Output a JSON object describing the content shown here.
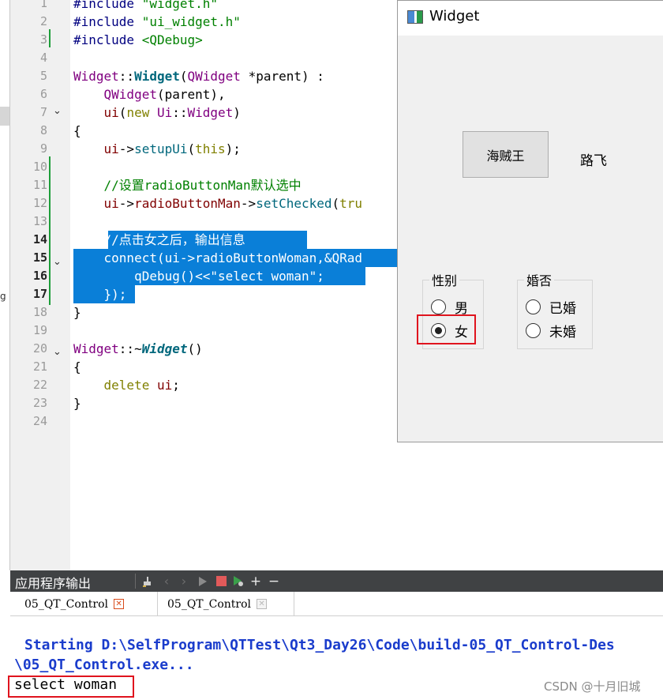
{
  "editor": {
    "line_numbers": [
      "1",
      "2",
      "3",
      "4",
      "5",
      "6",
      "7",
      "8",
      "9",
      "10",
      "11",
      "12",
      "13",
      "14",
      "15",
      "16",
      "17",
      "18",
      "19",
      "20",
      "21",
      "22",
      "23",
      "24"
    ],
    "lines": [
      {
        "t": [
          [
            "kw-dir",
            "#include "
          ],
          [
            "str",
            "\"widget.h\""
          ]
        ]
      },
      {
        "t": [
          [
            "kw-dir",
            "#include "
          ],
          [
            "str",
            "\"ui_widget.h\""
          ]
        ]
      },
      {
        "t": [
          [
            "kw-dir",
            "#include "
          ],
          [
            "str",
            "<QDebug>"
          ]
        ]
      },
      {
        "t": []
      },
      {
        "t": [
          [
            "cls",
            "Widget"
          ],
          [
            "op",
            "::"
          ],
          [
            "fn-bold",
            "Widget"
          ],
          [
            "op",
            "("
          ],
          [
            "cls",
            "QWidget"
          ],
          [
            "op",
            " *parent) :"
          ]
        ]
      },
      {
        "t": [
          [
            "op",
            "    "
          ],
          [
            "cls",
            "QWidget"
          ],
          [
            "op",
            "(parent),"
          ]
        ]
      },
      {
        "t": [
          [
            "op",
            "    "
          ],
          [
            "mem",
            "ui"
          ],
          [
            "op",
            "("
          ],
          [
            "kw",
            "new "
          ],
          [
            "cls",
            "Ui"
          ],
          [
            "op",
            "::"
          ],
          [
            "cls",
            "Widget"
          ],
          [
            "op",
            ")"
          ]
        ]
      },
      {
        "t": [
          [
            "op",
            "{"
          ]
        ]
      },
      {
        "t": [
          [
            "op",
            "    "
          ],
          [
            "mem",
            "ui"
          ],
          [
            "op",
            "->"
          ],
          [
            "fn",
            "setupUi"
          ],
          [
            "op",
            "("
          ],
          [
            "kw",
            "this"
          ],
          [
            "op",
            ");"
          ]
        ]
      },
      {
        "t": []
      },
      {
        "t": [
          [
            "op",
            "    "
          ],
          [
            "cmt",
            "//设置radioButtonMan默认选中"
          ]
        ]
      },
      {
        "t": [
          [
            "op",
            "    "
          ],
          [
            "mem",
            "ui"
          ],
          [
            "op",
            "->"
          ],
          [
            "mem",
            "radioButtonMan"
          ],
          [
            "op",
            "->"
          ],
          [
            "fn",
            "setChecked"
          ],
          [
            "op",
            "("
          ],
          [
            "kw",
            "tru"
          ]
        ]
      },
      {
        "t": []
      },
      {
        "t": [
          [
            "op",
            "    //点击女之后，输出信息 "
          ]
        ],
        "sel": true
      },
      {
        "t": [
          [
            "op",
            "    connect(ui->radioButtonWoman,&QRad"
          ]
        ],
        "sel": true
      },
      {
        "t": [
          [
            "op",
            "        qDebug()<<\"select woman\";"
          ]
        ],
        "sel": true
      },
      {
        "t": [
          [
            "op",
            "    });"
          ]
        ],
        "sel": true
      },
      {
        "t": [
          [
            "op",
            "}"
          ]
        ]
      },
      {
        "t": []
      },
      {
        "t": [
          [
            "cls",
            "Widget"
          ],
          [
            "op",
            "::~"
          ],
          [
            "fn-ital",
            "Widget"
          ],
          [
            "op",
            "()"
          ]
        ]
      },
      {
        "t": [
          [
            "op",
            "{"
          ]
        ]
      },
      {
        "t": [
          [
            "op",
            "    "
          ],
          [
            "kw",
            "delete "
          ],
          [
            "mem",
            "ui"
          ],
          [
            "op",
            ";"
          ]
        ]
      },
      {
        "t": [
          [
            "op",
            "}"
          ]
        ]
      },
      {
        "t": []
      }
    ],
    "left_glyph": "g"
  },
  "widget_window": {
    "title": "Widget",
    "button_label": "海贼王",
    "name_label": "路飞",
    "gender_group": {
      "title": "性别",
      "options": [
        {
          "label": "男",
          "checked": false
        },
        {
          "label": "女",
          "checked": true
        }
      ]
    },
    "marriage_group": {
      "title": "婚否",
      "options": [
        {
          "label": "已婚",
          "checked": false
        },
        {
          "label": "未婚",
          "checked": false
        }
      ]
    }
  },
  "output": {
    "pane_title": "应用程序输出",
    "tabs": [
      {
        "label": "05_QT_Control",
        "active": true
      },
      {
        "label": "05_QT_Control",
        "active": false
      }
    ],
    "lines": [
      "Starting D:\\SelfProgram\\QTTest\\Qt3_Day26\\Code\\build-05_QT_Control-Des",
      "\\05_QT_Control.exe...",
      "select woman"
    ],
    "watermark": "CSDN @十月旧城"
  },
  "colors": {
    "selection": "#0a7fd8",
    "highlight_box": "#e0141e",
    "output_bar": "#404244",
    "output_text": "#1a3ccc"
  }
}
